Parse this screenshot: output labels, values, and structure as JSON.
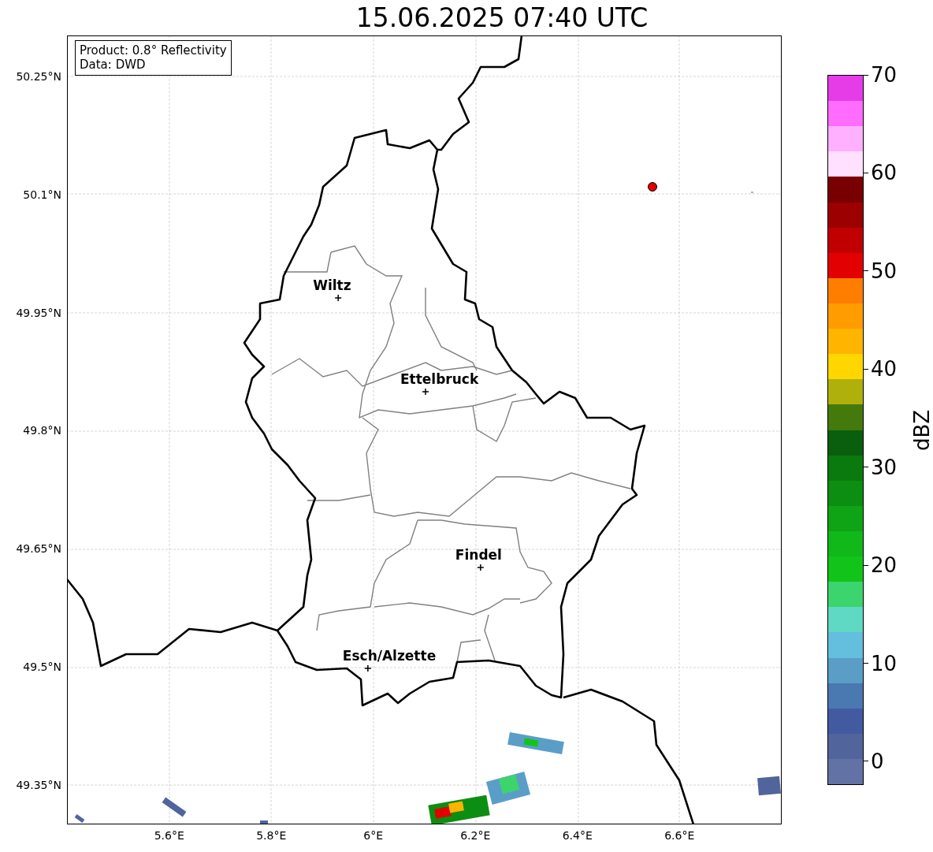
{
  "title": "15.06.2025 07:40 UTC",
  "info_box": [
    "Product: 0.8° Reflectivity",
    "Data: DWD"
  ],
  "y_ticks": [
    "50.25°N",
    "50.1°N",
    "49.95°N",
    "49.8°N",
    "49.65°N",
    "49.5°N",
    "49.35°N"
  ],
  "x_ticks": [
    "5.6°E",
    "5.8°E",
    "6°E",
    "6.2°E",
    "6.4°E",
    "6.6°E"
  ],
  "cities": [
    {
      "name": "Wiltz"
    },
    {
      "name": "Ettelbruck"
    },
    {
      "name": "Findel"
    },
    {
      "name": "Esch/Alzette"
    }
  ],
  "colorbar": {
    "label": "dBZ",
    "ticks": [
      "70",
      "60",
      "50",
      "40",
      "30",
      "20",
      "10",
      "0"
    ],
    "segments": [
      {
        "color": "#e63ce8"
      },
      {
        "color": "#ff6cff"
      },
      {
        "color": "#ffb0ff"
      },
      {
        "color": "#ffe0ff"
      },
      {
        "color": "#780000"
      },
      {
        "color": "#9c0000"
      },
      {
        "color": "#c00000"
      },
      {
        "color": "#e20000"
      },
      {
        "color": "#ff7e00"
      },
      {
        "color": "#ff9c00"
      },
      {
        "color": "#ffb400"
      },
      {
        "color": "#ffd600"
      },
      {
        "color": "#b0b00a"
      },
      {
        "color": "#447a0c"
      },
      {
        "color": "#095f0d"
      },
      {
        "color": "#0a7a0e"
      },
      {
        "color": "#0c8e12"
      },
      {
        "color": "#0ea416"
      },
      {
        "color": "#10b81a"
      },
      {
        "color": "#12c41a"
      },
      {
        "color": "#3cd46c"
      },
      {
        "color": "#5fd8c4"
      },
      {
        "color": "#64bede"
      },
      {
        "color": "#5a9ec8"
      },
      {
        "color": "#4a78b0"
      },
      {
        "color": "#425aa0"
      },
      {
        "color": "#52649c"
      },
      {
        "color": "#6272a4"
      }
    ]
  }
}
